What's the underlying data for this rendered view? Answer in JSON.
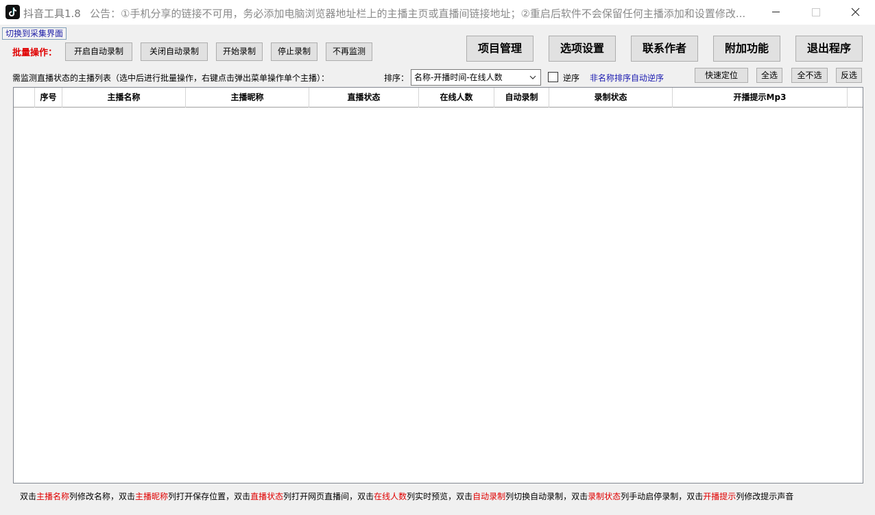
{
  "window": {
    "title": "抖音工具1.8",
    "notice": "公告：①手机分享的链接不可用，务必添加电脑浏览器地址栏上的主播主页或直播间链接地址；②重启后软件不会保留任何主播添加和设置修改..."
  },
  "switch_label": "切换到采集界面",
  "batch": {
    "label": "批量操作：",
    "buttons": [
      "开启自动录制",
      "关闭自动录制",
      "开始录制",
      "停止录制",
      "不再监测"
    ]
  },
  "main_buttons": [
    "项目管理",
    "选项设置",
    "联系作者",
    "附加功能",
    "退出程序"
  ],
  "list_desc": "需监测直播状态的主播列表（选中后进行批量操作，右键点击弹出菜单操作单个主播）：",
  "sort": {
    "label": "排序：",
    "selected": "名称-开播时间-在线人数",
    "reverse_label": "逆序",
    "hint": "非名称排序自动逆序"
  },
  "select_buttons": [
    "快速定位",
    "全选",
    "全不选",
    "反选"
  ],
  "table": {
    "columns": [
      "",
      "序号",
      "主播名称",
      "主播昵称",
      "直播状态",
      "在线人数",
      "自动录制",
      "录制状态",
      "开播提示Mp3"
    ]
  },
  "footer": {
    "parts": [
      {
        "t": "双击",
        "red": false
      },
      {
        "t": "主播名称",
        "red": true
      },
      {
        "t": "列修改名称，双击",
        "red": false
      },
      {
        "t": "主播昵称",
        "red": true
      },
      {
        "t": "列打开保存位置，双击",
        "red": false
      },
      {
        "t": "直播状态",
        "red": true
      },
      {
        "t": "列打开网页直播间，双击",
        "red": false
      },
      {
        "t": "在线人数",
        "red": true
      },
      {
        "t": "列实时预览，双击",
        "red": false
      },
      {
        "t": "自动录制",
        "red": true
      },
      {
        "t": "列切换自动录制，双击",
        "red": false
      },
      {
        "t": "录制状态",
        "red": true
      },
      {
        "t": "列手动启停录制，双击",
        "red": false
      },
      {
        "t": "开播提示",
        "red": true
      },
      {
        "t": "列修改提示声音",
        "red": false
      }
    ]
  },
  "colors": {
    "accent_red": "#e00000",
    "link_blue": "#1a1ab0"
  }
}
